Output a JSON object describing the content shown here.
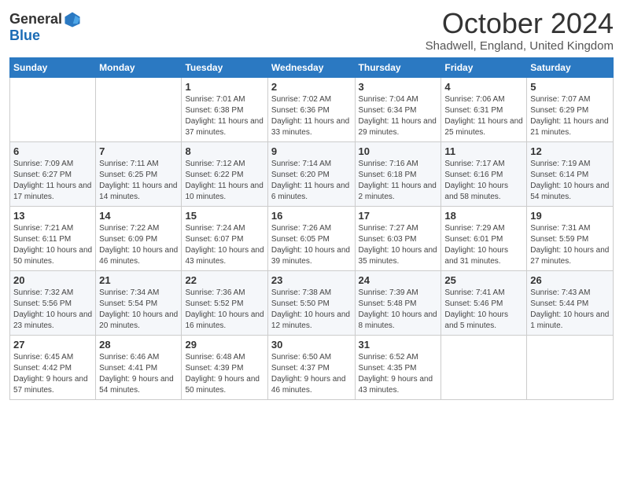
{
  "logo": {
    "general": "General",
    "blue": "Blue"
  },
  "title": "October 2024",
  "location": "Shadwell, England, United Kingdom",
  "days_of_week": [
    "Sunday",
    "Monday",
    "Tuesday",
    "Wednesday",
    "Thursday",
    "Friday",
    "Saturday"
  ],
  "weeks": [
    [
      {
        "day": "",
        "detail": ""
      },
      {
        "day": "",
        "detail": ""
      },
      {
        "day": "1",
        "detail": "Sunrise: 7:01 AM\nSunset: 6:38 PM\nDaylight: 11 hours and 37 minutes."
      },
      {
        "day": "2",
        "detail": "Sunrise: 7:02 AM\nSunset: 6:36 PM\nDaylight: 11 hours and 33 minutes."
      },
      {
        "day": "3",
        "detail": "Sunrise: 7:04 AM\nSunset: 6:34 PM\nDaylight: 11 hours and 29 minutes."
      },
      {
        "day": "4",
        "detail": "Sunrise: 7:06 AM\nSunset: 6:31 PM\nDaylight: 11 hours and 25 minutes."
      },
      {
        "day": "5",
        "detail": "Sunrise: 7:07 AM\nSunset: 6:29 PM\nDaylight: 11 hours and 21 minutes."
      }
    ],
    [
      {
        "day": "6",
        "detail": "Sunrise: 7:09 AM\nSunset: 6:27 PM\nDaylight: 11 hours and 17 minutes."
      },
      {
        "day": "7",
        "detail": "Sunrise: 7:11 AM\nSunset: 6:25 PM\nDaylight: 11 hours and 14 minutes."
      },
      {
        "day": "8",
        "detail": "Sunrise: 7:12 AM\nSunset: 6:22 PM\nDaylight: 11 hours and 10 minutes."
      },
      {
        "day": "9",
        "detail": "Sunrise: 7:14 AM\nSunset: 6:20 PM\nDaylight: 11 hours and 6 minutes."
      },
      {
        "day": "10",
        "detail": "Sunrise: 7:16 AM\nSunset: 6:18 PM\nDaylight: 11 hours and 2 minutes."
      },
      {
        "day": "11",
        "detail": "Sunrise: 7:17 AM\nSunset: 6:16 PM\nDaylight: 10 hours and 58 minutes."
      },
      {
        "day": "12",
        "detail": "Sunrise: 7:19 AM\nSunset: 6:14 PM\nDaylight: 10 hours and 54 minutes."
      }
    ],
    [
      {
        "day": "13",
        "detail": "Sunrise: 7:21 AM\nSunset: 6:11 PM\nDaylight: 10 hours and 50 minutes."
      },
      {
        "day": "14",
        "detail": "Sunrise: 7:22 AM\nSunset: 6:09 PM\nDaylight: 10 hours and 46 minutes."
      },
      {
        "day": "15",
        "detail": "Sunrise: 7:24 AM\nSunset: 6:07 PM\nDaylight: 10 hours and 43 minutes."
      },
      {
        "day": "16",
        "detail": "Sunrise: 7:26 AM\nSunset: 6:05 PM\nDaylight: 10 hours and 39 minutes."
      },
      {
        "day": "17",
        "detail": "Sunrise: 7:27 AM\nSunset: 6:03 PM\nDaylight: 10 hours and 35 minutes."
      },
      {
        "day": "18",
        "detail": "Sunrise: 7:29 AM\nSunset: 6:01 PM\nDaylight: 10 hours and 31 minutes."
      },
      {
        "day": "19",
        "detail": "Sunrise: 7:31 AM\nSunset: 5:59 PM\nDaylight: 10 hours and 27 minutes."
      }
    ],
    [
      {
        "day": "20",
        "detail": "Sunrise: 7:32 AM\nSunset: 5:56 PM\nDaylight: 10 hours and 23 minutes."
      },
      {
        "day": "21",
        "detail": "Sunrise: 7:34 AM\nSunset: 5:54 PM\nDaylight: 10 hours and 20 minutes."
      },
      {
        "day": "22",
        "detail": "Sunrise: 7:36 AM\nSunset: 5:52 PM\nDaylight: 10 hours and 16 minutes."
      },
      {
        "day": "23",
        "detail": "Sunrise: 7:38 AM\nSunset: 5:50 PM\nDaylight: 10 hours and 12 minutes."
      },
      {
        "day": "24",
        "detail": "Sunrise: 7:39 AM\nSunset: 5:48 PM\nDaylight: 10 hours and 8 minutes."
      },
      {
        "day": "25",
        "detail": "Sunrise: 7:41 AM\nSunset: 5:46 PM\nDaylight: 10 hours and 5 minutes."
      },
      {
        "day": "26",
        "detail": "Sunrise: 7:43 AM\nSunset: 5:44 PM\nDaylight: 10 hours and 1 minute."
      }
    ],
    [
      {
        "day": "27",
        "detail": "Sunrise: 6:45 AM\nSunset: 4:42 PM\nDaylight: 9 hours and 57 minutes."
      },
      {
        "day": "28",
        "detail": "Sunrise: 6:46 AM\nSunset: 4:41 PM\nDaylight: 9 hours and 54 minutes."
      },
      {
        "day": "29",
        "detail": "Sunrise: 6:48 AM\nSunset: 4:39 PM\nDaylight: 9 hours and 50 minutes."
      },
      {
        "day": "30",
        "detail": "Sunrise: 6:50 AM\nSunset: 4:37 PM\nDaylight: 9 hours and 46 minutes."
      },
      {
        "day": "31",
        "detail": "Sunrise: 6:52 AM\nSunset: 4:35 PM\nDaylight: 9 hours and 43 minutes."
      },
      {
        "day": "",
        "detail": ""
      },
      {
        "day": "",
        "detail": ""
      }
    ]
  ]
}
